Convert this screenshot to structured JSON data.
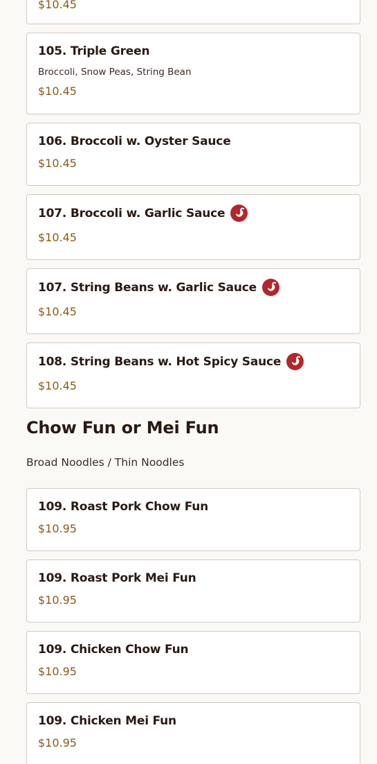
{
  "colors": {
    "background": "#fbf9f6",
    "card_border": "#cfc9c4",
    "price": "#8a5a1c",
    "spicy_badge": "#b4262b"
  },
  "menu_items_top": [
    {
      "name": "",
      "price": "$10.45"
    },
    {
      "name": "105. Triple Green",
      "description": "Broccoli, Snow Peas, String Bean",
      "price": "$10.45"
    },
    {
      "name": "106. Broccoli w. Oyster Sauce",
      "price": "$10.45"
    },
    {
      "name": "107. Broccoli w. Garlic Sauce",
      "price": "$10.45",
      "spicy": true
    },
    {
      "name": "107. String Beans w. Garlic Sauce",
      "price": "$10.45",
      "spicy": true
    },
    {
      "name": "108. String Beans w. Hot Spicy Sauce",
      "price": "$10.45",
      "spicy": true
    }
  ],
  "section": {
    "title": "Chow Fun or Mei Fun",
    "subtitle": "Broad Noodles / Thin Noodles",
    "items": [
      {
        "name": "109. Roast Pork Chow Fun",
        "price": "$10.95"
      },
      {
        "name": "109. Roast Pork Mei Fun",
        "price": "$10.95"
      },
      {
        "name": "109. Chicken Chow Fun",
        "price": "$10.95"
      },
      {
        "name": "109. Chicken Mei Fun",
        "price": "$10.95"
      }
    ]
  },
  "icons": {
    "spicy": "chili-pepper-icon"
  }
}
